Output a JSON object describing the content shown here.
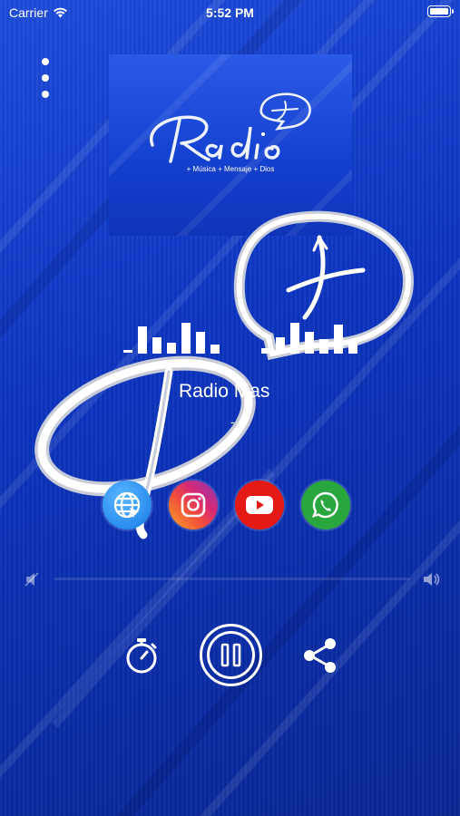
{
  "status_bar": {
    "carrier": "Carrier",
    "time": "5:52 PM",
    "battery_level": 1.0
  },
  "cover": {
    "logo_text": "Radio",
    "tagline": "+ Música + Mensaje + Dios"
  },
  "station": {
    "name": "Radio Mas",
    "subtitle": "-"
  },
  "social": [
    {
      "name": "website",
      "icon": "globe-icon",
      "color": "#1e90ff"
    },
    {
      "name": "instagram",
      "icon": "instagram-icon",
      "color": "#e1306c"
    },
    {
      "name": "youtube",
      "icon": "youtube-icon",
      "color": "#e62117"
    },
    {
      "name": "whatsapp",
      "icon": "whatsapp-icon",
      "color": "#25a244"
    }
  ],
  "volume": {
    "level": 0.0
  },
  "controls": {
    "timer": "stopwatch-icon",
    "play_state": "pause-icon",
    "share": "share-icon"
  },
  "colors": {
    "background": "#0b2fb0",
    "accent": "#ffffff"
  }
}
